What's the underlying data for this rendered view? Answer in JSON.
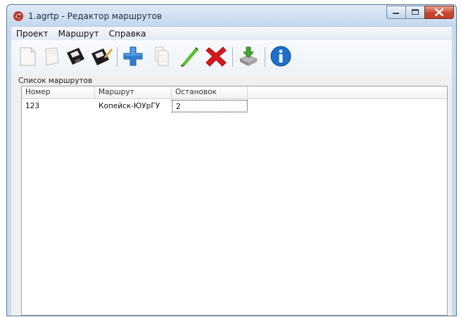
{
  "window": {
    "title": "1.agrtp - Редактор маршрутов"
  },
  "menu": {
    "items": [
      "Проект",
      "Маршрут",
      "Справка"
    ]
  },
  "toolbar": {
    "buttons": [
      {
        "icon": "new-document-icon"
      },
      {
        "icon": "open-folder-icon"
      },
      {
        "icon": "save-floppy-icon"
      },
      {
        "icon": "save-as-floppy-icon"
      },
      {
        "icon": "add-plus-icon"
      },
      {
        "icon": "copy-document-icon"
      },
      {
        "icon": "edit-pencil-icon"
      },
      {
        "icon": "delete-cross-icon"
      },
      {
        "icon": "export-download-icon"
      },
      {
        "icon": "info-icon"
      }
    ]
  },
  "routes": {
    "group_label": "Список маршрутов",
    "columns": [
      "Номер",
      "Маршрут",
      "Остановок"
    ],
    "rows": [
      [
        "123",
        "Копейск-ЮУрГУ",
        "2"
      ]
    ]
  }
}
